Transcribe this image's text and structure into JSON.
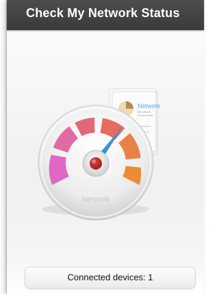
{
  "header": {
    "title": "Check My Network Status"
  },
  "card": {
    "title": "Network",
    "line1": "Info network",
    "line2": "Info all devices"
  },
  "gauge": {
    "label": "Network"
  },
  "status": {
    "connected_label": "Connected devices: 1"
  },
  "colors": {
    "title_bar": "#444444",
    "needle": "#3d8fd6",
    "segment_pink": "#de68c4",
    "segment_red": "#e06a6a",
    "segment_orange": "#ec8a36"
  }
}
